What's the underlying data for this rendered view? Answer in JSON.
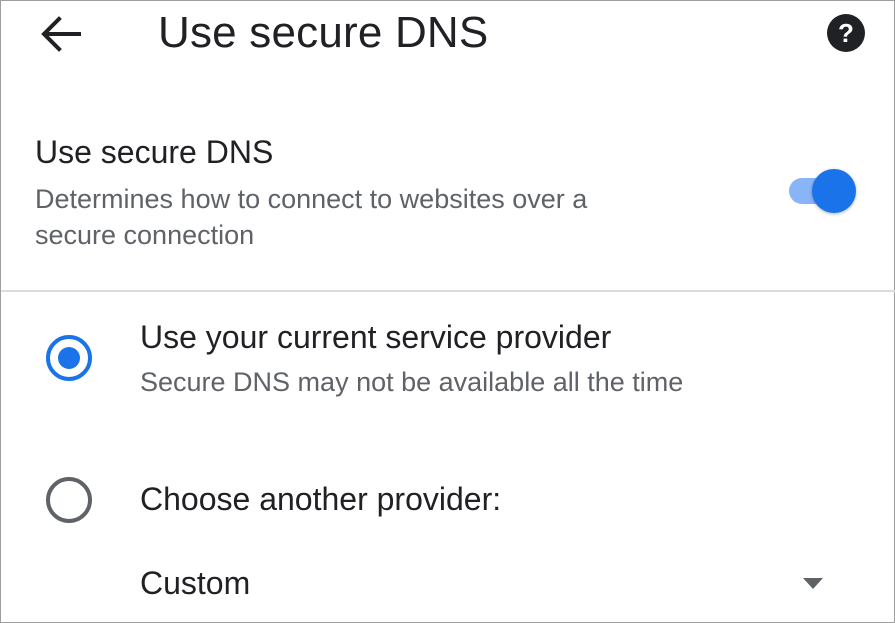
{
  "header": {
    "title": "Use secure DNS",
    "back_icon": "arrow-back-icon",
    "help_icon": "help-circle-icon"
  },
  "setting": {
    "title": "Use secure DNS",
    "description": "Determines how to connect to websites over a secure connection",
    "toggle_on": true
  },
  "options": [
    {
      "title": "Use your current service provider",
      "description": "Secure DNS may not be available all the time",
      "selected": true
    },
    {
      "title": "Choose another provider:",
      "selected": false
    }
  ],
  "provider_select": {
    "value": "Custom",
    "icon": "dropdown-arrow-icon"
  },
  "colors": {
    "accent": "#1a73e8",
    "toggle_track": "#8ab4f8",
    "primary_text": "#202124",
    "secondary_text": "#5f6368",
    "divider": "#dadce0"
  }
}
